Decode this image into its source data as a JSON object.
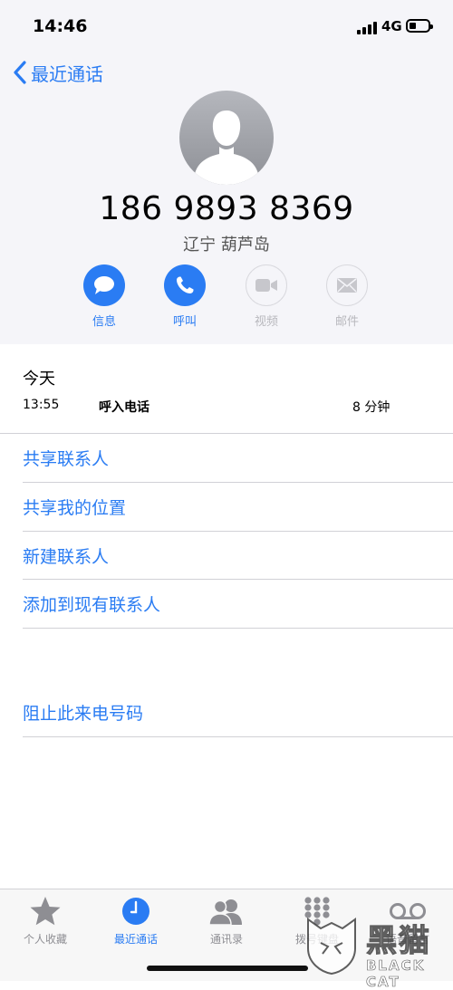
{
  "status_bar": {
    "time": "14:46",
    "network": "4G",
    "battery_level": 0.35
  },
  "nav": {
    "back_label": "最近通话"
  },
  "contact": {
    "phone": "186 9893 8369",
    "location": "辽宁 葫芦岛"
  },
  "actions": [
    {
      "label": "信息",
      "icon": "message-icon",
      "enabled": true
    },
    {
      "label": "呼叫",
      "icon": "phone-icon",
      "enabled": true
    },
    {
      "label": "视频",
      "icon": "video-icon",
      "enabled": false
    },
    {
      "label": "邮件",
      "icon": "mail-icon",
      "enabled": false
    }
  ],
  "history": {
    "heading": "今天",
    "calls": [
      {
        "time": "13:55",
        "type": "呼入电话",
        "duration": "8 分钟"
      }
    ]
  },
  "options": [
    "共享联系人",
    "共享我的位置",
    "新建联系人",
    "添加到现有联系人"
  ],
  "block_label": "阻止此来电号码",
  "tabs": [
    {
      "label": "个人收藏",
      "icon": "star-icon",
      "selected": false
    },
    {
      "label": "最近通话",
      "icon": "clock-icon",
      "selected": true
    },
    {
      "label": "通讯录",
      "icon": "contacts-icon",
      "selected": false
    },
    {
      "label": "拨号键盘",
      "icon": "keypad-icon",
      "selected": false
    },
    {
      "label": "语音留言",
      "icon": "voicemail-icon",
      "selected": false
    }
  ],
  "watermark": {
    "cn": "黑猫",
    "en": "BLACK CAT"
  },
  "colors": {
    "accent": "#2a7cf3",
    "header_bg": "#f5f5f9",
    "inactive": "#b8b8bd"
  }
}
